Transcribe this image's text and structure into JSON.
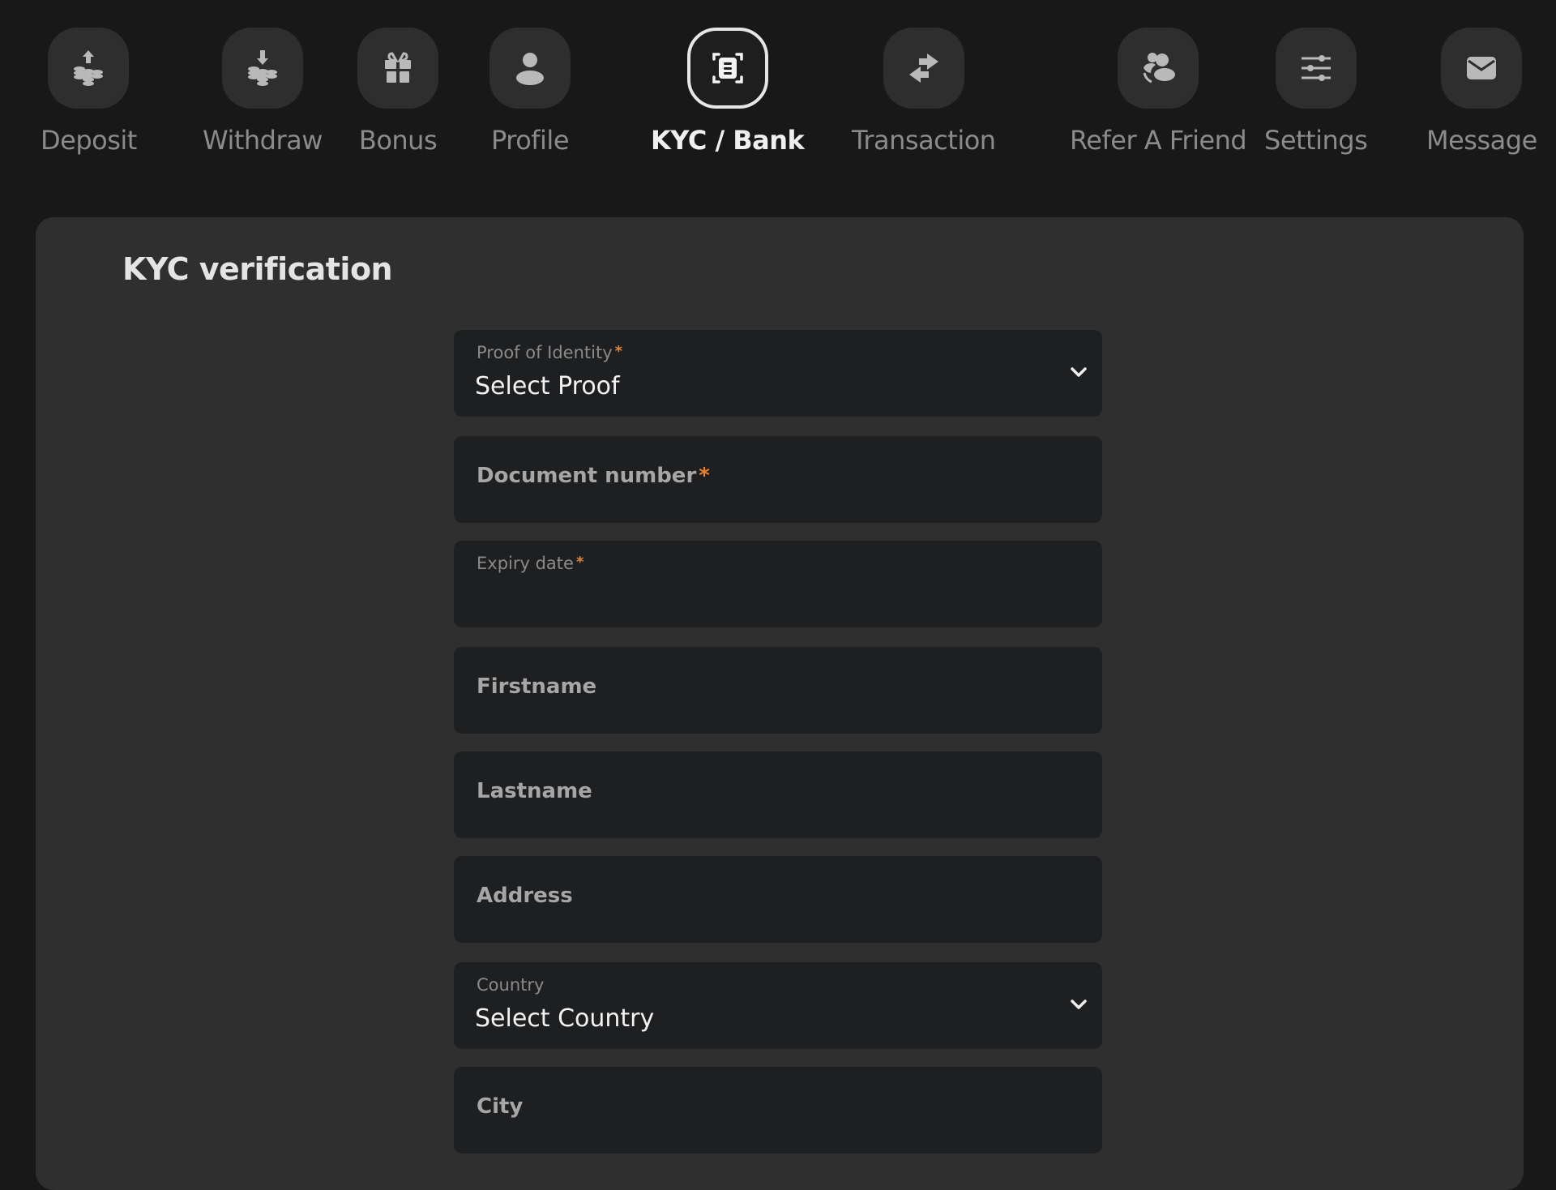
{
  "nav": {
    "items": [
      {
        "id": "deposit",
        "label": "Deposit",
        "icon": "deposit-coins-up-icon",
        "active": false
      },
      {
        "id": "withdraw",
        "label": "Withdraw",
        "icon": "withdraw-coins-down-icon",
        "active": false
      },
      {
        "id": "bonus",
        "label": "Bonus",
        "icon": "gift-icon",
        "active": false
      },
      {
        "id": "profile",
        "label": "Profile",
        "icon": "user-icon",
        "active": false
      },
      {
        "id": "kyc-bank",
        "label": "KYC / Bank",
        "icon": "document-scan-icon",
        "active": true
      },
      {
        "id": "transaction",
        "label": "Transaction",
        "icon": "swap-arrows-icon",
        "active": false
      },
      {
        "id": "refer-a-friend",
        "label": "Refer A Friend",
        "icon": "users-refer-icon",
        "active": false
      },
      {
        "id": "settings",
        "label": "Settings",
        "icon": "sliders-icon",
        "active": false
      },
      {
        "id": "message",
        "label": "Message",
        "icon": "envelope-icon",
        "active": false
      }
    ]
  },
  "kyc": {
    "title": "KYC verification",
    "required_mark": "*",
    "fields": {
      "proof": {
        "label": "Proof of Identity",
        "required": true,
        "type": "select",
        "value": "Select Proof"
      },
      "document_number": {
        "placeholder": "Document number",
        "required": true,
        "type": "text",
        "value": ""
      },
      "expiry_date": {
        "label": "Expiry date",
        "required": true,
        "type": "date",
        "value": ""
      },
      "firstname": {
        "placeholder": "Firstname",
        "required": false,
        "type": "text",
        "value": ""
      },
      "lastname": {
        "placeholder": "Lastname",
        "required": false,
        "type": "text",
        "value": ""
      },
      "address": {
        "placeholder": "Address",
        "required": false,
        "type": "text",
        "value": ""
      },
      "country": {
        "label": "Country",
        "required": false,
        "type": "select",
        "value": "Select Country"
      },
      "city": {
        "placeholder": "City",
        "required": false,
        "type": "text",
        "value": ""
      }
    }
  },
  "colors": {
    "background": "#181818",
    "card": "#2f2f2f",
    "field": "#1e1f21",
    "required": "#e8822e",
    "active": "#f0f0f0",
    "inactive": "#8b8b8b"
  }
}
